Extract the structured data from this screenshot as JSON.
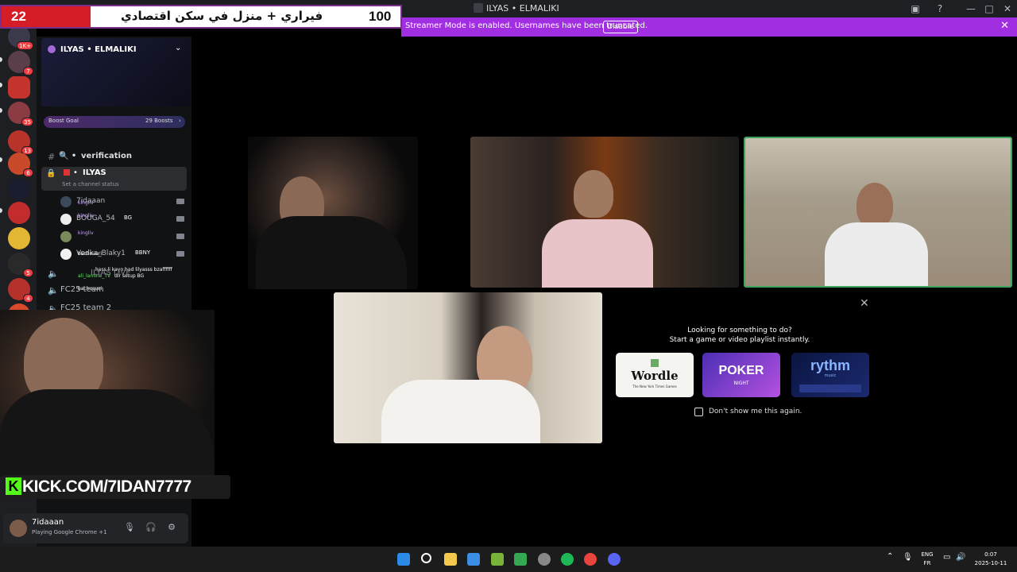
{
  "window": {
    "title": "ILYAS • ELMALIKI"
  },
  "banner": {
    "text": "Streamer Mode is enabled. Usernames have been truncated.",
    "disable_label": "Disable"
  },
  "overlay_counter": {
    "left_value": "22",
    "title": "فيراري + منزل في سكن اقتصادي",
    "right_value": "100"
  },
  "rail": {
    "badges": [
      "1K+",
      "7",
      "35",
      "13",
      "6",
      "5",
      "4"
    ]
  },
  "server": {
    "name": "ILYAS • ELMALIKI",
    "boost_goal_label": "Boost Goal",
    "boost_count": "29 Boosts"
  },
  "channels": [
    {
      "name": "verification",
      "prefix": "🔍 •"
    },
    {
      "name": "ILYAS",
      "prefix": "•",
      "status": "Set a channel status"
    }
  ],
  "voice_users": [
    {
      "name": "7idaaan"
    },
    {
      "name": "BOUGA_54",
      "tag": "BG"
    },
    {
      "name": "Vodka_Blaky1",
      "tag": "BBNY"
    }
  ],
  "chat_lines": [
    {
      "user": "kingliv",
      "text": ""
    },
    {
      "user": "kingliv",
      "text": ""
    },
    {
      "user": "kingliv",
      "text": ""
    },
    {
      "user": "bachouuri",
      "text": ""
    },
    {
      "user": "",
      "text": "hass li kayo had lilyasss bzaffffff"
    },
    {
      "user": "ali_lamine_TV",
      "text": "dir setup BG"
    },
    {
      "user": "bachouuri",
      "text": ""
    }
  ],
  "voice_channels": [
    {
      "name": "ILYAS LIVE"
    },
    {
      "name": "FC25 team"
    },
    {
      "name": "FC25 team 2"
    }
  ],
  "webcam_overlay": {
    "url": "KICK.COM/7IDAN7777",
    "logo": "K"
  },
  "user_panel": {
    "name": "7idaaan",
    "status": "Playing Google Chrome +1"
  },
  "activity": {
    "title_line1": "Looking for something to do?",
    "title_line2": "Start a game or video playlist instantly.",
    "cards": [
      {
        "label": "Wordle",
        "sub": "The New York Times Games"
      },
      {
        "label": "POKER",
        "sub": "NIGHT"
      },
      {
        "label": "rythm",
        "sub": "music"
      }
    ],
    "dont_show_label": "Don't show me this again."
  },
  "taskbar": {
    "lang_top": "ENG",
    "lang_bottom": "FR",
    "time": "0:07",
    "date": "2025-10-11"
  },
  "colors": {
    "banner": "#a12ee0",
    "speaking_ring": "#3ba55c",
    "kick_green": "#53fc18",
    "badge_red": "#f23f43"
  }
}
